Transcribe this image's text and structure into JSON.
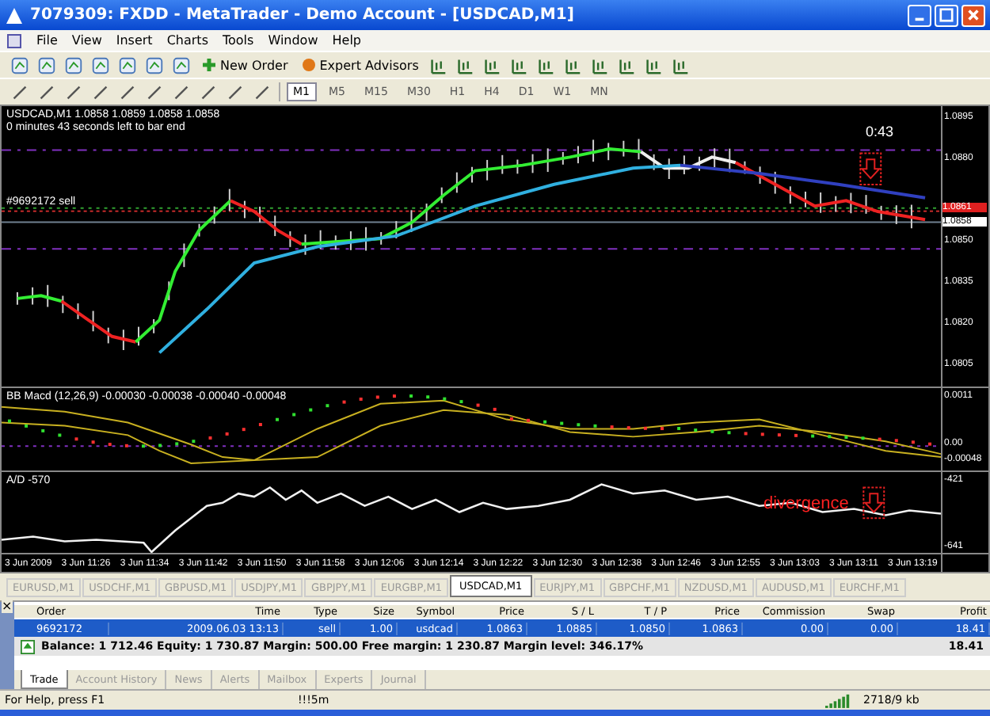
{
  "window": {
    "title": "7079309: FXDD - MetaTrader - Demo Account - [USDCAD,M1]"
  },
  "menu": [
    "File",
    "View",
    "Insert",
    "Charts",
    "Tools",
    "Window",
    "Help"
  ],
  "toolbar": {
    "new_order": "New Order",
    "expert_advisors": "Expert Advisors",
    "timeframes": [
      {
        "label": "M1",
        "selected": true
      },
      {
        "label": "M5",
        "selected": false
      },
      {
        "label": "M15",
        "selected": false
      },
      {
        "label": "M30",
        "selected": false
      },
      {
        "label": "H1",
        "selected": false
      },
      {
        "label": "H4",
        "selected": false
      },
      {
        "label": "D1",
        "selected": false
      },
      {
        "label": "W1",
        "selected": false
      },
      {
        "label": "MN",
        "selected": false
      }
    ]
  },
  "chart": {
    "legend": "USDCAD,M1  1.0858 1.0859 1.0858 1.0858",
    "timer_text": "0 minutes 43 seconds left to bar end",
    "countdown": "0:43",
    "order_label": "#9692172 sell",
    "price_ticks": [
      "1.0895",
      "1.0880",
      "1.0850",
      "1.0835",
      "1.0820",
      "1.0805"
    ],
    "ask_label": "1.0861",
    "bid_label": "1.0858",
    "macd": {
      "legend": "BB Macd (12,26,9) -0.00030 -0.00038 -0.00040 -0.00048",
      "ticks": [
        "0.0011",
        "0.00",
        "-0.00048"
      ]
    },
    "ad": {
      "legend": "A/D -570",
      "annotation": "divergence",
      "ticks": [
        "-421",
        "-641"
      ]
    },
    "time_ticks": [
      "3 Jun 2009",
      "3 Jun 11:26",
      "3 Jun 11:34",
      "3 Jun 11:42",
      "3 Jun 11:50",
      "3 Jun 11:58",
      "3 Jun 12:06",
      "3 Jun 12:14",
      "3 Jun 12:22",
      "3 Jun 12:30",
      "3 Jun 12:38",
      "3 Jun 12:46",
      "3 Jun 12:55",
      "3 Jun 13:03",
      "3 Jun 13:11",
      "3 Jun 13:19"
    ]
  },
  "symbol_tabs": [
    {
      "label": "EURUSD,M1",
      "selected": false
    },
    {
      "label": "USDCHF,M1",
      "selected": false
    },
    {
      "label": "GBPUSD,M1",
      "selected": false
    },
    {
      "label": "USDJPY,M1",
      "selected": false
    },
    {
      "label": "GBPJPY,M1",
      "selected": false
    },
    {
      "label": "EURGBP,M1",
      "selected": false
    },
    {
      "label": "USDCAD,M1",
      "selected": true
    },
    {
      "label": "EURJPY,M1",
      "selected": false
    },
    {
      "label": "GBPCHF,M1",
      "selected": false
    },
    {
      "label": "NZDUSD,M1",
      "selected": false
    },
    {
      "label": "AUDUSD,M1",
      "selected": false
    },
    {
      "label": "EURCHF,M1",
      "selected": false
    }
  ],
  "terminal": {
    "close": "×",
    "columns": [
      "Order",
      "Time",
      "Type",
      "Size",
      "Symbol",
      "Price",
      "S / L",
      "T / P",
      "Price",
      "Commission",
      "Swap",
      "Profit"
    ],
    "orders": [
      {
        "cells": [
          "9692172",
          "2009.06.03 13:13",
          "sell",
          "1.00",
          "usdcad",
          "1.0863",
          "1.0885",
          "1.0850",
          "1.0863",
          "0.00",
          "0.00",
          "18.41"
        ],
        "selected": true
      }
    ],
    "summary": "Balance: 1 712.46  Equity: 1 730.87  Margin: 500.00  Free margin: 1 230.87  Margin level: 346.17%",
    "summary_profit": "18.41",
    "tabs": [
      {
        "label": "Trade",
        "selected": true
      },
      {
        "label": "Account History",
        "selected": false
      },
      {
        "label": "News",
        "selected": false
      },
      {
        "label": "Alerts",
        "selected": false
      },
      {
        "label": "Mailbox",
        "selected": false
      },
      {
        "label": "Experts",
        "selected": false
      },
      {
        "label": "Journal",
        "selected": false
      }
    ]
  },
  "status_bar": {
    "help": "For Help, press F1",
    "profile": "!!!5m",
    "traffic": "2718/9 kb"
  }
}
